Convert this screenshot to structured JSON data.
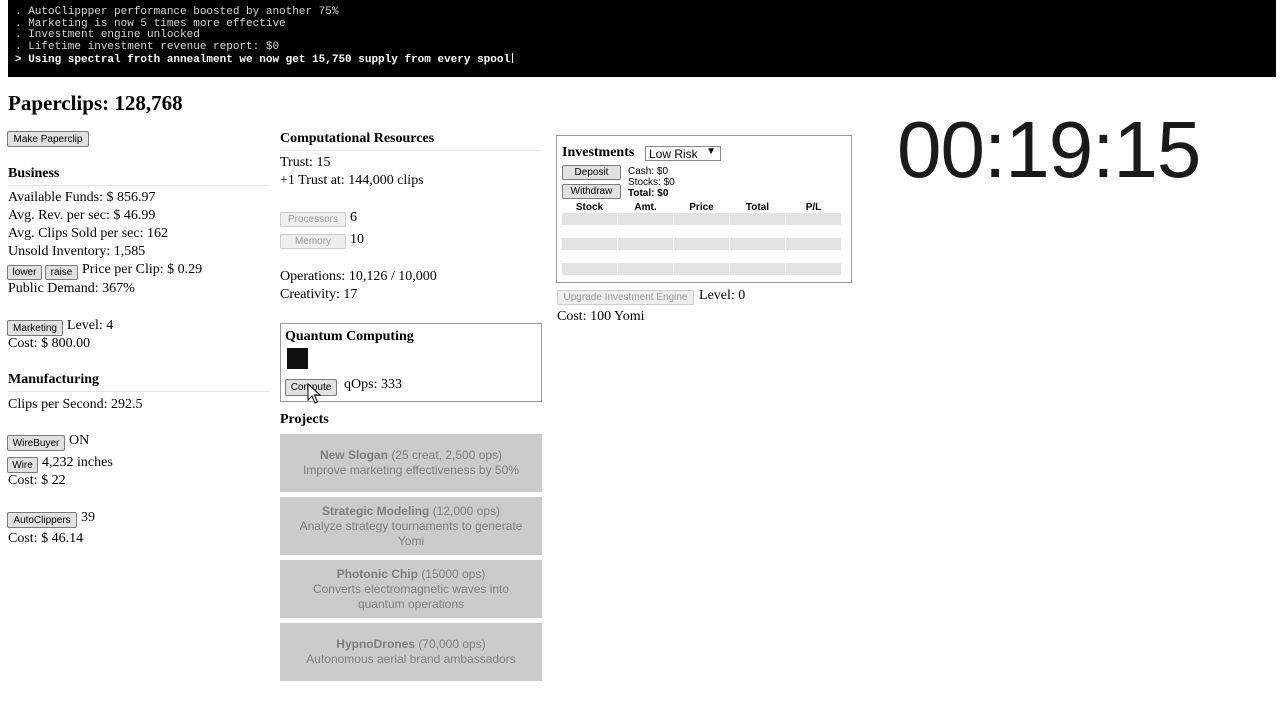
{
  "console": {
    "lines": [
      ". AutoClippper performance boosted by another 75%",
      ". Marketing is now 5 times more effective",
      ". Investment engine unlocked",
      ". Lifetime investment revenue report: $0"
    ],
    "current": "> Using spectral froth annealment we now get 15,750 supply from every spool"
  },
  "paperclips": "Paperclips: 128,768",
  "make_paperclip": "Make Paperclip",
  "business": {
    "title": "Business",
    "funds": "Available Funds: $ 856.97",
    "rev": "Avg. Rev. per sec: $ 46.99",
    "sold": "Avg. Clips Sold per sec: 162",
    "inventory": "Unsold Inventory: 1,585",
    "lower": "lower",
    "raise": "raise",
    "price": "Price per Clip: $ 0.29",
    "demand": "Public Demand: 367%",
    "marketing_btn": "Marketing",
    "marketing_level": "Level: 4",
    "marketing_cost": "Cost: $ 800.00"
  },
  "manufacturing": {
    "title": "Manufacturing",
    "cps": "Clips per Second: 292.5",
    "wirebuyer_btn": "WireBuyer",
    "wirebuyer_state": "ON",
    "wire_btn": "Wire",
    "wire_amount": "4,232 inches",
    "wire_cost": "Cost: $ 22",
    "autoclippers_btn": "AutoClippers",
    "autoclippers_count": "39",
    "autoclippers_cost": "Cost: $ 46.14"
  },
  "computational": {
    "title": "Computational Resources",
    "trust": "Trust: 15",
    "next_trust": "+1 Trust at: 144,000 clips",
    "processors_btn": "Processors",
    "processors": "6",
    "memory_btn": "Memory",
    "memory": "10",
    "operations": "Operations: 10,126 / 10,000",
    "creativity": "Creativity: 17"
  },
  "quantum": {
    "title": "Quantum Computing",
    "compute_btn": "Compute",
    "qops": "qOps: 333"
  },
  "projects": {
    "title": "Projects",
    "items": [
      {
        "name": "New Slogan",
        "cost": "(25 creat, 2,500 ops)",
        "desc": "Improve marketing effectiveness by 50%"
      },
      {
        "name": "Strategic Modeling",
        "cost": "(12,000 ops)",
        "desc": "Analyze strategy tournaments to generate Yomi"
      },
      {
        "name": "Photonic Chip",
        "cost": "(15000 ops)",
        "desc": "Converts electromagnetic waves into quantum operations"
      },
      {
        "name": "HypnoDrones",
        "cost": "(70,000 ops)",
        "desc": "Autonomous aerial brand ambassadors"
      }
    ]
  },
  "investments": {
    "title": "Investments",
    "risk": "Low Risk",
    "deposit": "Deposit",
    "withdraw": "Withdraw",
    "cash": "Cash: $0",
    "stocks": "Stocks: $0",
    "total": "Total: $0",
    "columns": [
      "Stock",
      "Amt.",
      "Price",
      "Total",
      "P/L"
    ],
    "upgrade_btn": "Upgrade Investment Engine",
    "level": "Level: 0",
    "cost": "Cost: 100 Yomi"
  },
  "timer": "00:19:15",
  "colors": {
    "console_bg": "#000000",
    "project_bg": "#cbcbcb",
    "project_text": "#7e7e7e"
  }
}
